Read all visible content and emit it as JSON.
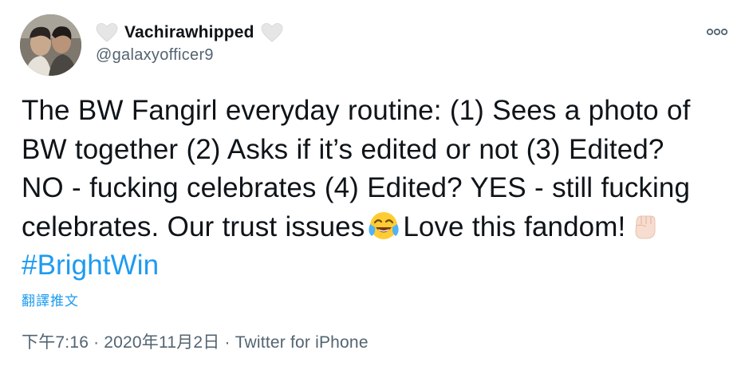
{
  "author": {
    "display_name": "Vachirawhipped",
    "handle": "@galaxyofficer9",
    "avatar_icon": "profile-photo",
    "name_decoration_icon": "white-heart-icon"
  },
  "tweet": {
    "lines": [
      "The BW Fangirl everyday routine: (1) Sees a photo of",
      "BW together (2) Asks if it’s edited or not (3) Edited?",
      "NO - fucking celebrates (4) Edited? YES - still fucking"
    ],
    "line4_before_emoji": "celebrates. Our trust issues",
    "line4_emoji_1": "face-with-tears-of-joy",
    "line4_middle": "Love this fandom!",
    "line4_emoji_2": "raised-fist-light-skin-tone",
    "hashtag": "#BrightWin"
  },
  "translate_label": "翻譯推文",
  "meta": {
    "time": "下午7:16",
    "separator": "·",
    "date": "2020年11月2日",
    "source": "Twitter for iPhone"
  },
  "more_icon": "more-options-icon",
  "colors": {
    "link": "#1d9bf0",
    "secondary_text": "#536471",
    "primary_text": "#0f1419"
  }
}
